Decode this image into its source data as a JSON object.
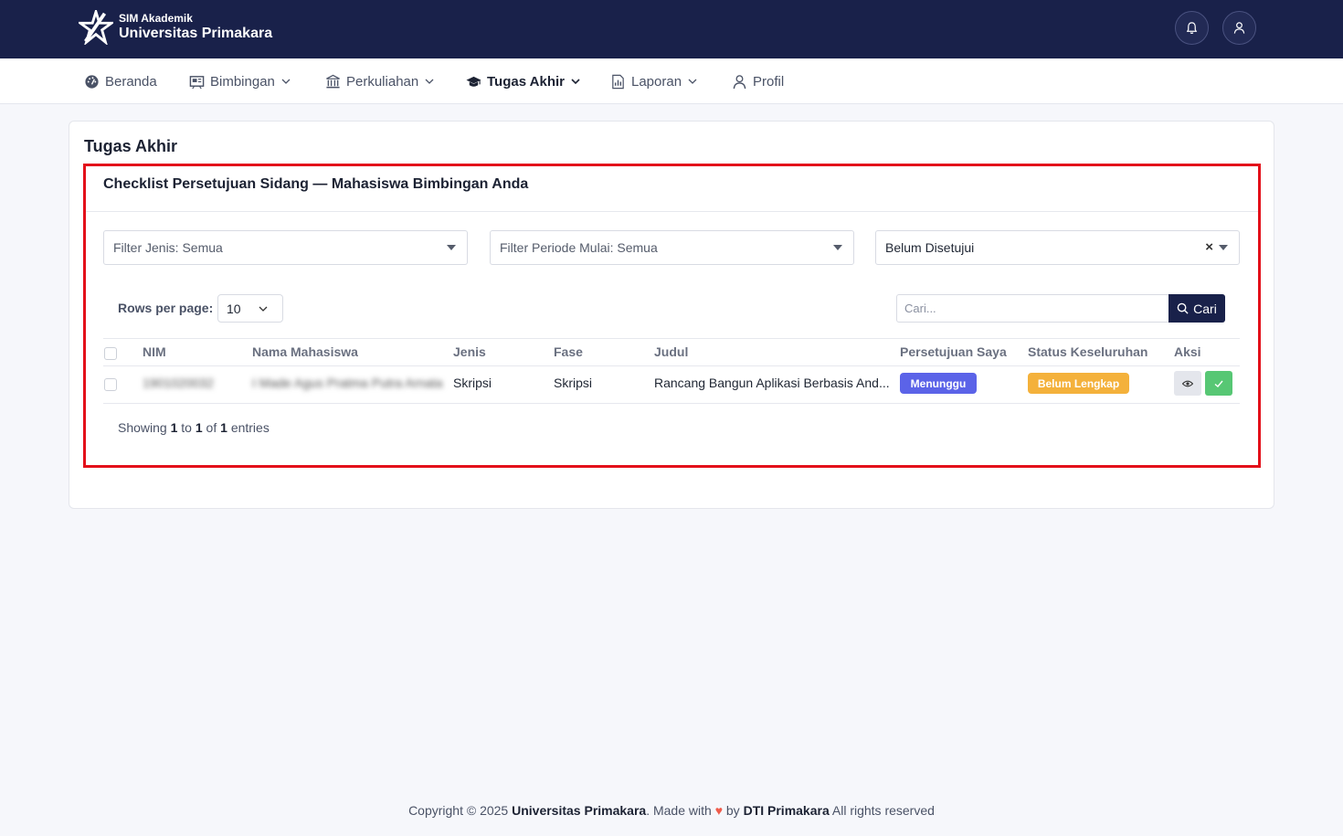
{
  "header": {
    "brand_sub": "SIM Akademik",
    "brand_main": "Universitas Primakara",
    "icons": [
      "bell-icon",
      "user-icon"
    ]
  },
  "menu": [
    {
      "label": "Beranda",
      "icon": "dashboard-icon",
      "has_dropdown": false,
      "active": false
    },
    {
      "label": "Bimbingan",
      "icon": "presentation-icon",
      "has_dropdown": true,
      "active": false
    },
    {
      "label": "Perkuliahan",
      "icon": "institution-icon",
      "has_dropdown": true,
      "active": false
    },
    {
      "label": "Tugas Akhir",
      "icon": "graduation-cap-icon",
      "has_dropdown": true,
      "active": true
    },
    {
      "label": "Laporan",
      "icon": "report-icon",
      "has_dropdown": true,
      "active": false
    },
    {
      "label": "Profil",
      "icon": "user-icon",
      "has_dropdown": false,
      "active": false
    }
  ],
  "page": {
    "title": "Tugas Akhir",
    "section_title": "Checklist Persetujuan Sidang — Mahasiswa Bimbingan Anda"
  },
  "filters": {
    "jenis": "Filter Jenis: Semua",
    "periode": "Filter Periode Mulai: Semua",
    "status": "Belum Disetujui",
    "status_clear": "×"
  },
  "table_controls": {
    "rows_label": "Rows per page:",
    "rows_value": "10",
    "search_placeholder": "Cari...",
    "search_button": "Cari"
  },
  "table": {
    "columns": [
      "NIM",
      "Nama Mahasiswa",
      "Jenis",
      "Fase",
      "Judul",
      "Persetujuan Saya",
      "Status Keseluruhan",
      "Aksi"
    ],
    "rows": [
      {
        "nim": "1901020032",
        "nama": "I Made Agus Pratma Putra Arnata",
        "jenis": "Skripsi",
        "fase": "Skripsi",
        "judul": "Rancang Bangun Aplikasi Berbasis And...",
        "persetujuan": "Menunggu",
        "status": "Belum Lengkap"
      }
    ]
  },
  "pagination": {
    "showing": "Showing",
    "from": "1",
    "to_word": "to",
    "to": "1",
    "of_word": "of",
    "total": "1",
    "entries": "entries"
  },
  "footer": {
    "copyright": "Copyright © 2025",
    "org": "Universitas Primakara",
    "made_with": ". Made with",
    "heart": "♥",
    "by": "by",
    "team": "DTI Primakara",
    "rights": "All rights reserved"
  },
  "colors": {
    "navy": "#19214a",
    "badge_waiting": "#5b63e8",
    "badge_incomplete": "#f4b13b",
    "approve_green": "#57c774",
    "highlight_red": "#e3101a"
  }
}
